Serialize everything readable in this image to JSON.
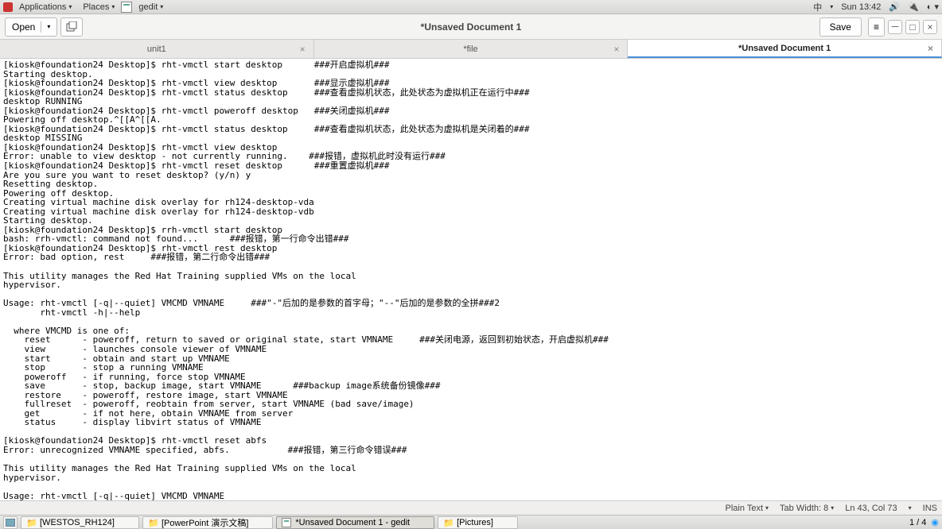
{
  "top_panel": {
    "applications": "Applications",
    "places": "Places",
    "gedit": "gedit",
    "lang": "中",
    "clock": "Sun 13:42"
  },
  "toolbar": {
    "open": "Open",
    "save": "Save",
    "title": "*Unsaved Document 1"
  },
  "tabs": [
    {
      "label": "unit1",
      "active": false,
      "close": true
    },
    {
      "label": "*file",
      "active": false,
      "close": true
    },
    {
      "label": "*Unsaved Document 1",
      "active": true,
      "close": true
    }
  ],
  "editor_text": "[kiosk@foundation24 Desktop]$ rht-vmctl start desktop      ###开启虚拟机###\nStarting desktop.\n[kiosk@foundation24 Desktop]$ rht-vmctl view desktop       ###显示虚拟机###\n[kiosk@foundation24 Desktop]$ rht-vmctl status desktop     ###查看虚拟机状态，此处状态为虚拟机正在运行中###\ndesktop RUNNING\n[kiosk@foundation24 Desktop]$ rht-vmctl poweroff desktop   ###关闭虚拟机###\nPowering off desktop.^[[A^[[A.\n[kiosk@foundation24 Desktop]$ rht-vmctl status desktop     ###查看虚拟机状态，此处状态为虚拟机是关闭着的###\ndesktop MISSING\n[kiosk@foundation24 Desktop]$ rht-vmctl view desktop\nError: unable to view desktop - not currently running.    ###报错，虚拟机此时没有运行###\n[kiosk@foundation24 Desktop]$ rht-vmctl reset desktop      ###重置虚拟机###\nAre you sure you want to reset desktop? (y/n) y\nResetting desktop.\nPowering off desktop.\nCreating virtual machine disk overlay for rh124-desktop-vda\nCreating virtual machine disk overlay for rh124-desktop-vdb\nStarting desktop.\n[kiosk@foundation24 Desktop]$ rrh-vmctl start desktop\nbash: rrh-vmctl: command not found...      ###报错，第一行命令出错###\n[kiosk@foundation24 Desktop]$ rht-vmctl rest desktop\nError: bad option, rest     ###报错，第二行命令出错###\n\nThis utility manages the Red Hat Training supplied VMs on the local\nhypervisor.\n\nUsage: rht-vmctl [-q|--quiet] VMCMD VMNAME     ###\"-\"后加的是参数的首字母；\"--\"后加的是参数的全拼###2\n       rht-vmctl -h|--help\n\n  where VMCMD is one of:\n    reset      - poweroff, return to saved or original state, start VMNAME     ###关闭电源，返回到初始状态，开启虚拟机###\n    view       - launches console viewer of VMNAME\n    start      - obtain and start up VMNAME\n    stop       - stop a running VMNAME\n    poweroff   - if running, force stop VMNAME\n    save       - stop, backup image, start VMNAME      ###backup image系统备份镜像###\n    restore    - poweroff, restore image, start VMNAME\n    fullreset  - poweroff, reobtain from server, start VMNAME (bad save/image)\n    get        - if not here, obtain VMNAME from server\n    status     - display libvirt status of VMNAME\n\n[kiosk@foundation24 Desktop]$ rht-vmctl reset abfs\nError: unrecognized VMNAME specified, abfs.           ###报错，第三行命令错误###\n\nThis utility manages the Red Hat Training supplied VMs on the local\nhypervisor.\n\nUsage: rht-vmctl [-q|--quiet] VMCMD VMNAME\n       rht-vmctl -h|--help",
  "statusbar": {
    "syntax": "Plain Text",
    "tabwidth": "Tab Width: 8",
    "position": "Ln 43, Col 73",
    "insert": "INS"
  },
  "bottom_panel": {
    "tasks": [
      {
        "label": "[WESTOS_RH124]",
        "active": false,
        "icon": "folder"
      },
      {
        "label": "[PowerPoint 演示文稿]",
        "active": false,
        "icon": "folder"
      },
      {
        "label": "*Unsaved Document 1 - gedit",
        "active": true,
        "icon": "gedit"
      },
      {
        "label": "[Pictures]",
        "active": false,
        "icon": "folder"
      }
    ],
    "workspace": "1 / 4"
  }
}
